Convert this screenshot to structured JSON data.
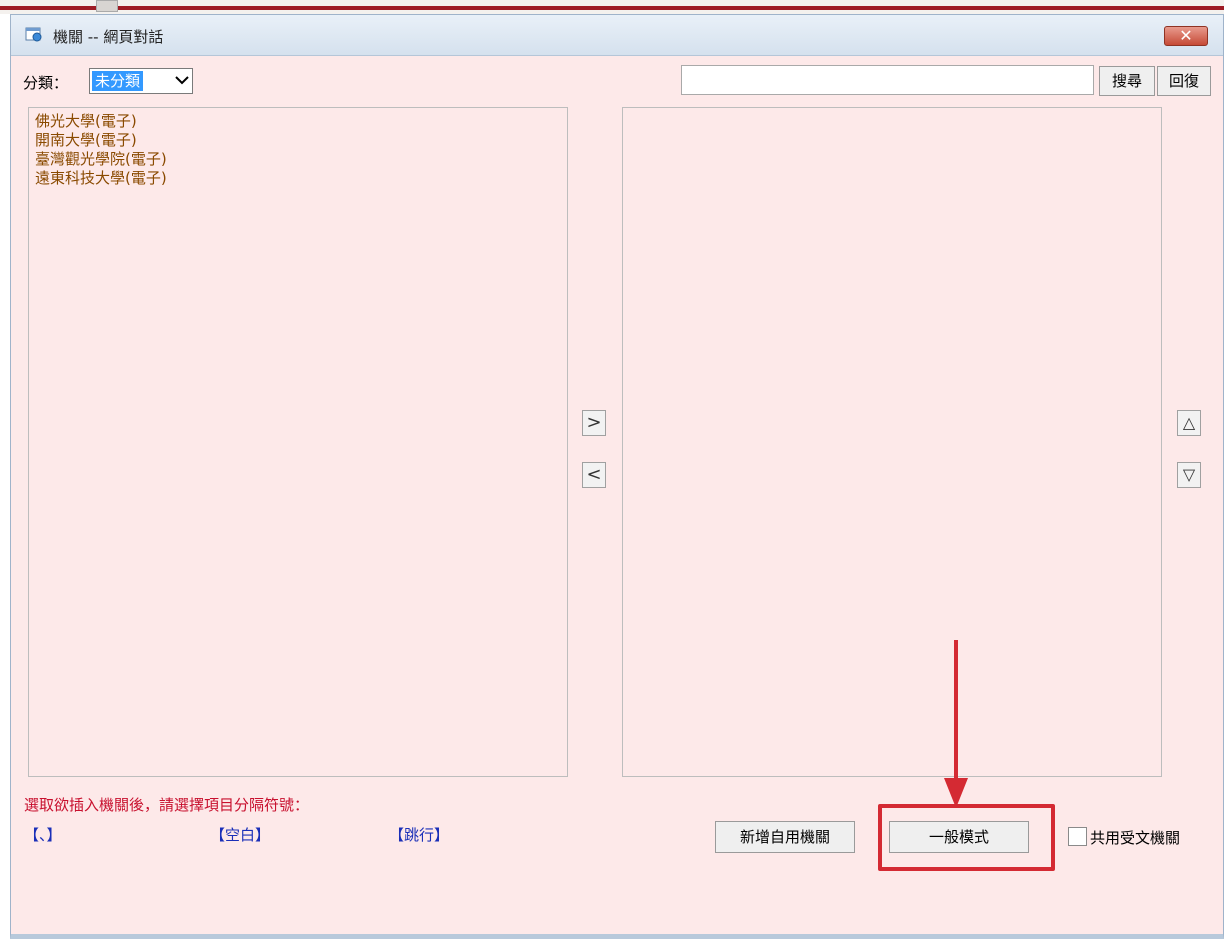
{
  "window": {
    "title": "機關 -- 網頁對話",
    "close_symbol": "✕"
  },
  "category": {
    "label": "分類：",
    "selected": "未分類"
  },
  "search": {
    "value": "",
    "search_label": "搜尋",
    "reset_label": "回復"
  },
  "left_list": {
    "items": [
      {
        "label": "佛光大學(電子)"
      },
      {
        "label": "開南大學(電子)"
      },
      {
        "label": "臺灣觀光學院(電子)"
      },
      {
        "label": "遠東科技大學(電子)"
      }
    ]
  },
  "right_list": {
    "items": []
  },
  "transfer": {
    "right_label": ">",
    "left_label": "<",
    "up_label": "△",
    "down_label": "▽"
  },
  "separator": {
    "hint": "選取欲插入機關後，請選擇項目分隔符號：",
    "options": [
      "【、】",
      "【空白】",
      "【跳行】"
    ]
  },
  "actions": {
    "add_custom_label": "新增自用機關",
    "normal_mode_label": "一般模式"
  },
  "shared": {
    "label": "共用受文機關",
    "checked": false
  },
  "colors": {
    "dialog_bg": "#fde9e9",
    "list_text": "#8a4a00",
    "hint_red": "#c8102e",
    "link_blue": "#1a2fb8",
    "annotation_red": "#d42a33"
  }
}
